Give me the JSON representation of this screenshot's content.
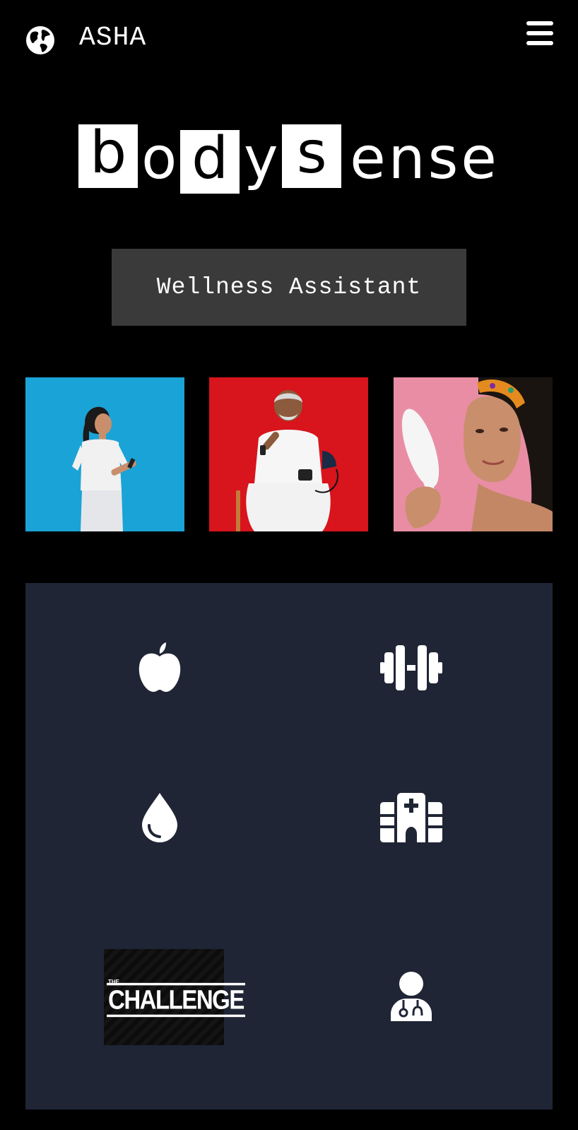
{
  "header": {
    "brand": "ASHA",
    "globe_icon": "globe-icon",
    "menu_icon": "hamburger-menu-icon"
  },
  "logo": {
    "letters": [
      "b",
      "o",
      "d",
      "y",
      "s",
      "ense"
    ],
    "boxed": [
      true,
      false,
      true,
      false,
      true,
      false
    ]
  },
  "assistant_button": {
    "label": "Wellness Assistant"
  },
  "photos": [
    {
      "subject": "woman-using-phone",
      "background": "#1aa3d6"
    },
    {
      "subject": "man-with-blood-pressure-monitor",
      "background": "#d8141c"
    },
    {
      "subject": "woman-with-mirror",
      "background": "#e98da5"
    }
  ],
  "features": [
    {
      "icon": "apple-icon",
      "name": "nutrition"
    },
    {
      "icon": "dumbbell-icon",
      "name": "fitness"
    },
    {
      "icon": "water-drop-icon",
      "name": "hydration"
    },
    {
      "icon": "hospital-icon",
      "name": "hospitals"
    },
    {
      "image_text_small": "THE",
      "image_text_large": "CHALLENGE",
      "name": "challenge"
    },
    {
      "icon": "doctor-icon",
      "name": "doctor"
    }
  ],
  "colors": {
    "page_background": "#000000",
    "button_background": "#3a3a3a",
    "panel_background": "#1f2535",
    "foreground": "#ffffff"
  }
}
